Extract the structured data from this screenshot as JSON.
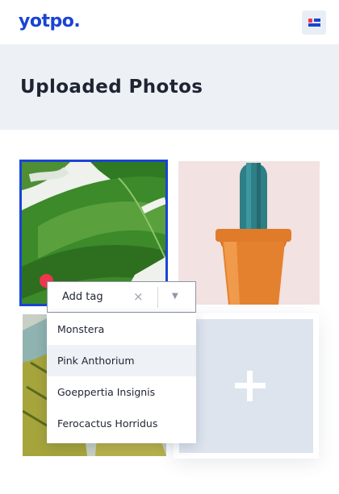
{
  "brand": {
    "logo_text": "yotpo.",
    "accent_color": "#1a44d6",
    "alert_color": "#f0354c"
  },
  "header": {
    "menu_icon": "menu-icon"
  },
  "page": {
    "title": "Uploaded Photos"
  },
  "photos": [
    {
      "subject": "monstera-leaf",
      "selected": true
    },
    {
      "subject": "cactus-in-orange-pot",
      "selected": false
    },
    {
      "subject": "striped-leaves",
      "selected": false
    }
  ],
  "tag_dropdown": {
    "placeholder": "Add tag",
    "clear_glyph": "×",
    "chevron_glyph": "▼",
    "options": [
      "Monstera",
      "Pink Anthorium",
      "Goeppertia Insignis",
      "Ferocactus Horridus"
    ],
    "highlighted_index": 1
  },
  "add_tile": {
    "icon": "plus-icon"
  }
}
